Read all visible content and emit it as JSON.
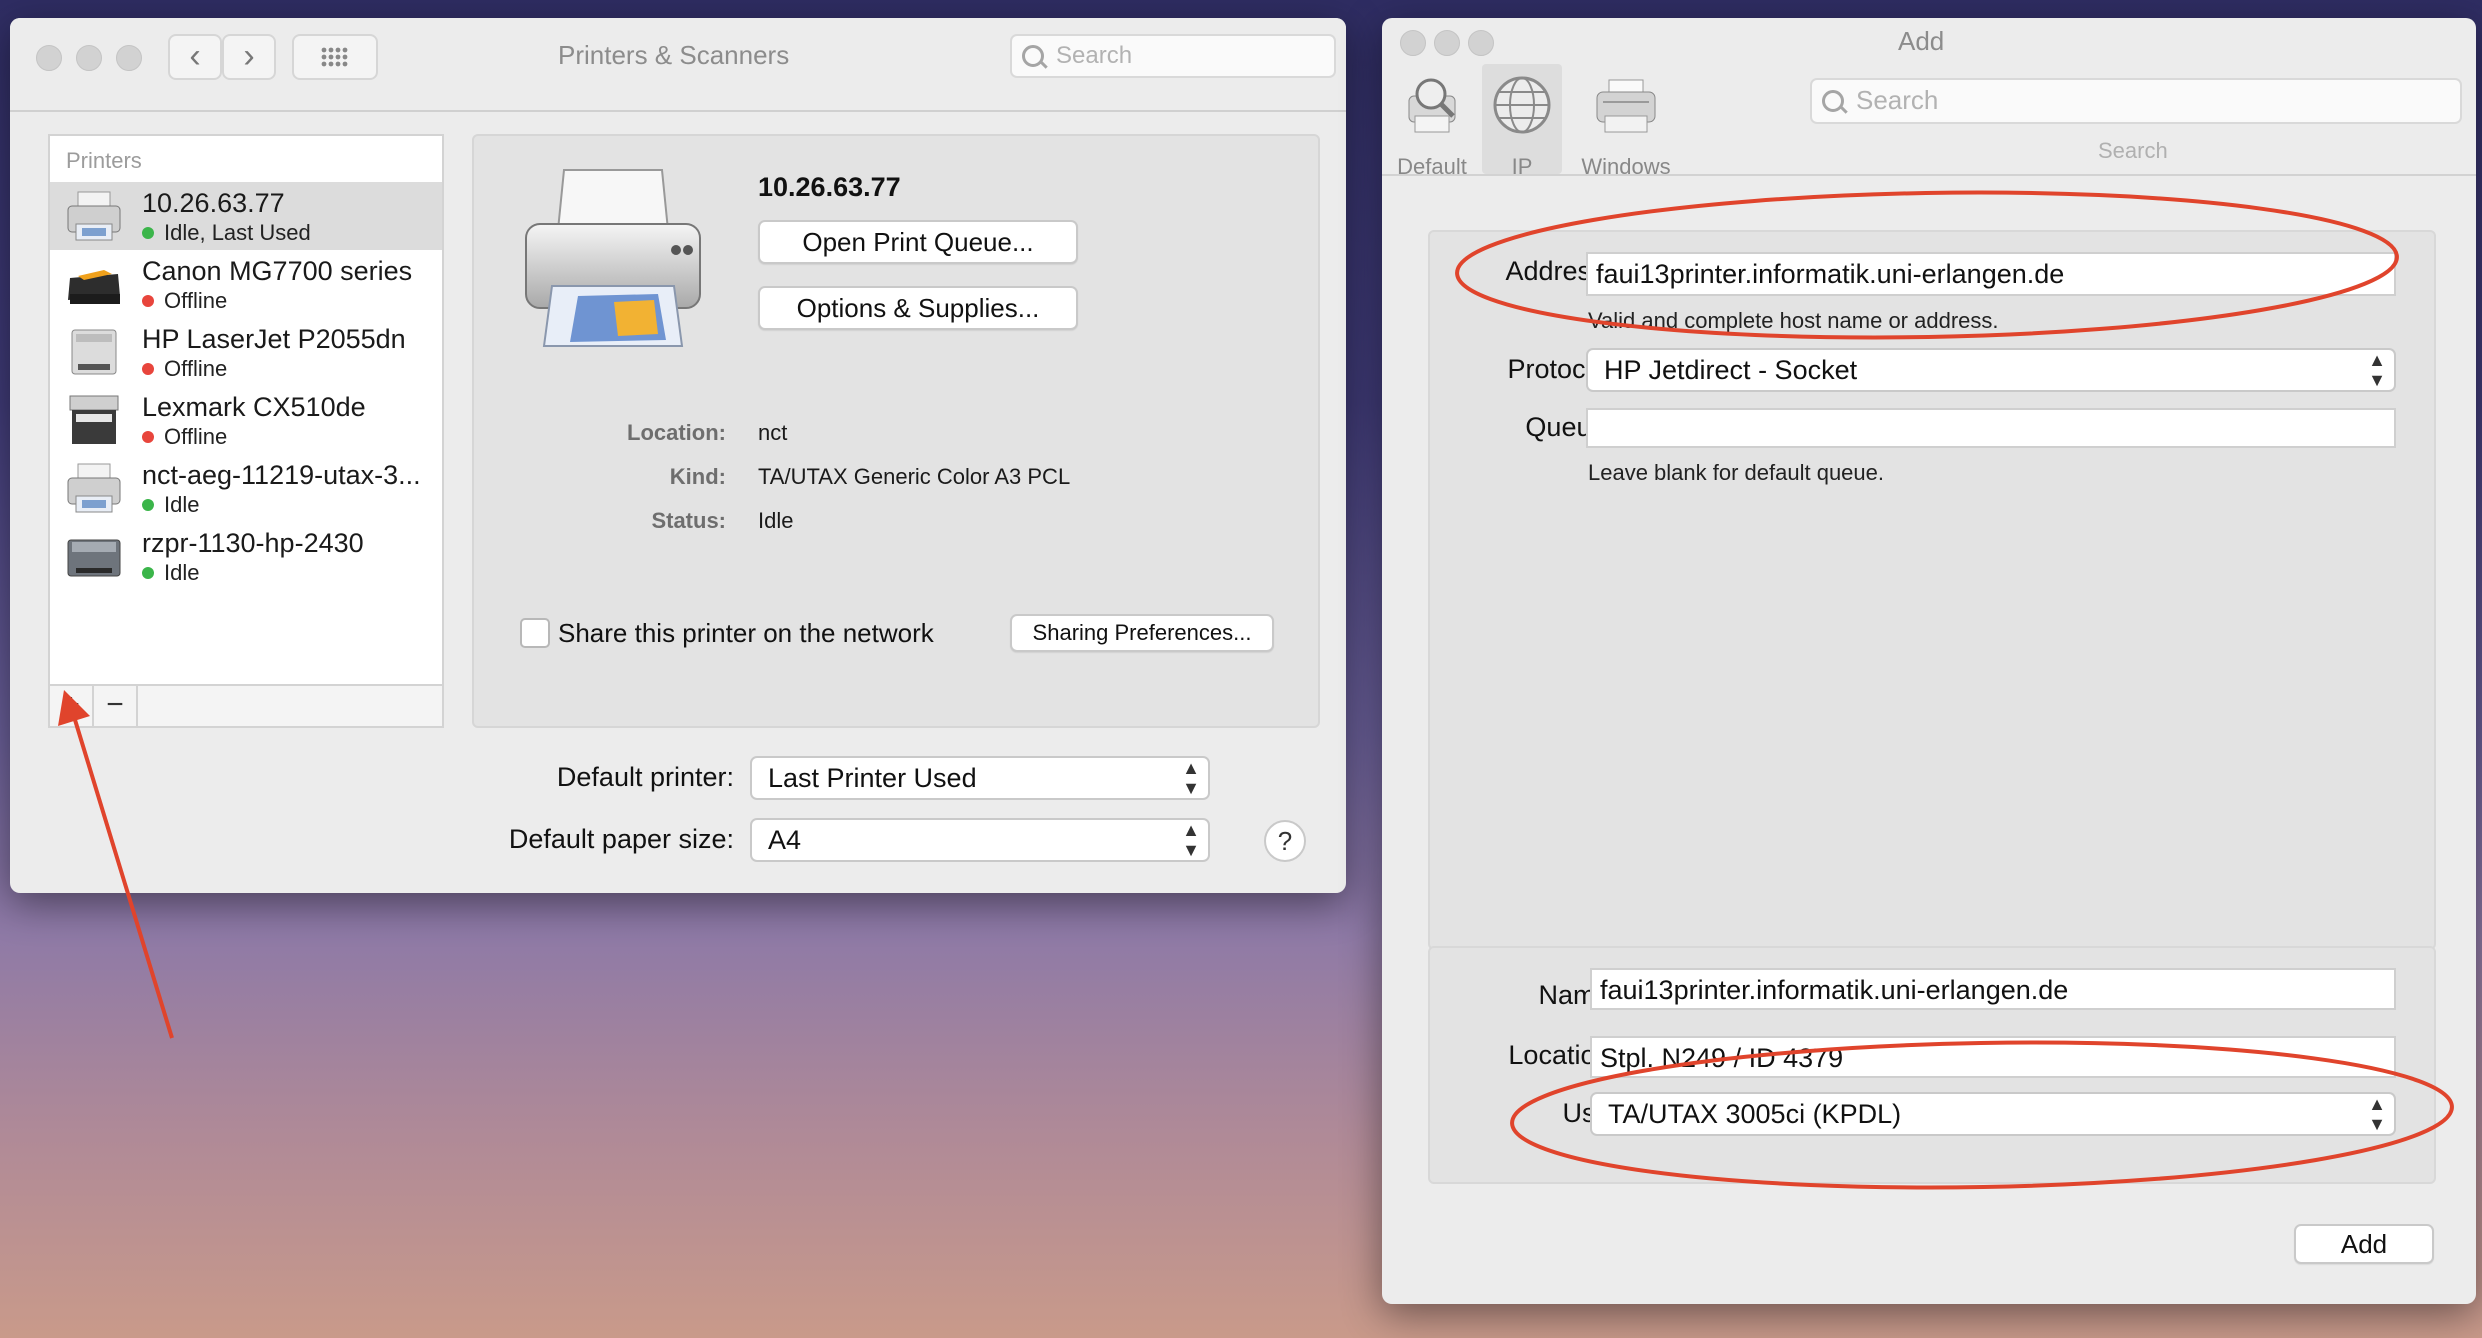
{
  "left_window": {
    "title": "Printers & Scanners",
    "search_placeholder": "Search",
    "list_header": "Printers",
    "printers": [
      {
        "name": "10.26.63.77",
        "status": "Idle, Last Used",
        "status_color": "green",
        "icon": "inkjet-printer-icon"
      },
      {
        "name": "Canon MG7700 series",
        "status": "Offline",
        "status_color": "red",
        "icon": "multifunction-printer-icon"
      },
      {
        "name": "HP LaserJet P2055dn",
        "status": "Offline",
        "status_color": "red",
        "icon": "laser-printer-icon"
      },
      {
        "name": "Lexmark CX510de",
        "status": "Offline",
        "status_color": "red",
        "icon": "mfp-printer-icon"
      },
      {
        "name": "nct-aeg-11219-utax-3...",
        "status": "Idle",
        "status_color": "green",
        "icon": "inkjet-printer-icon"
      },
      {
        "name": "rzpr-1130-hp-2430",
        "status": "Idle",
        "status_color": "green",
        "icon": "laser-printer-icon"
      }
    ],
    "add_symbol": "+",
    "remove_symbol": "−",
    "detail": {
      "printer_name": "10.26.63.77",
      "open_queue_label": "Open Print Queue...",
      "options_label": "Options & Supplies...",
      "location_label": "Location:",
      "location_value": "nct",
      "kind_label": "Kind:",
      "kind_value": "TA/UTAX Generic Color A3 PCL",
      "status_label": "Status:",
      "status_value": "Idle",
      "share_label": "Share this printer on the network",
      "sharing_prefs_label": "Sharing Preferences..."
    },
    "default_printer_label": "Default printer:",
    "default_printer_value": "Last Printer Used",
    "default_paper_label": "Default paper size:",
    "default_paper_value": "A4",
    "help_symbol": "?"
  },
  "right_window": {
    "title": "Add",
    "toolbar": [
      {
        "label": "Default",
        "icon": "default-printer-icon"
      },
      {
        "label": "IP",
        "icon": "globe-icon"
      },
      {
        "label": "Windows",
        "icon": "windows-printer-icon"
      }
    ],
    "search_placeholder": "Search",
    "search_caption": "Search",
    "address_label": "Address:",
    "address_value": "faui13printer.informatik.uni-erlangen.de",
    "address_hint": "Valid and complete host name or address.",
    "protocol_label": "Protocol:",
    "protocol_value": "HP Jetdirect - Socket",
    "queue_label": "Queue:",
    "queue_value": "",
    "queue_hint": "Leave blank for default queue.",
    "name_label": "Name:",
    "name_value": "faui13printer.informatik.uni-erlangen.de",
    "location_label": "Location:",
    "location_value": "Stpl. N249 / ID 4379",
    "use_label": "Use:",
    "use_value": "TA/UTAX 3005ci (KPDL)",
    "add_button": "Add"
  },
  "annotation_color": "#e0442c"
}
